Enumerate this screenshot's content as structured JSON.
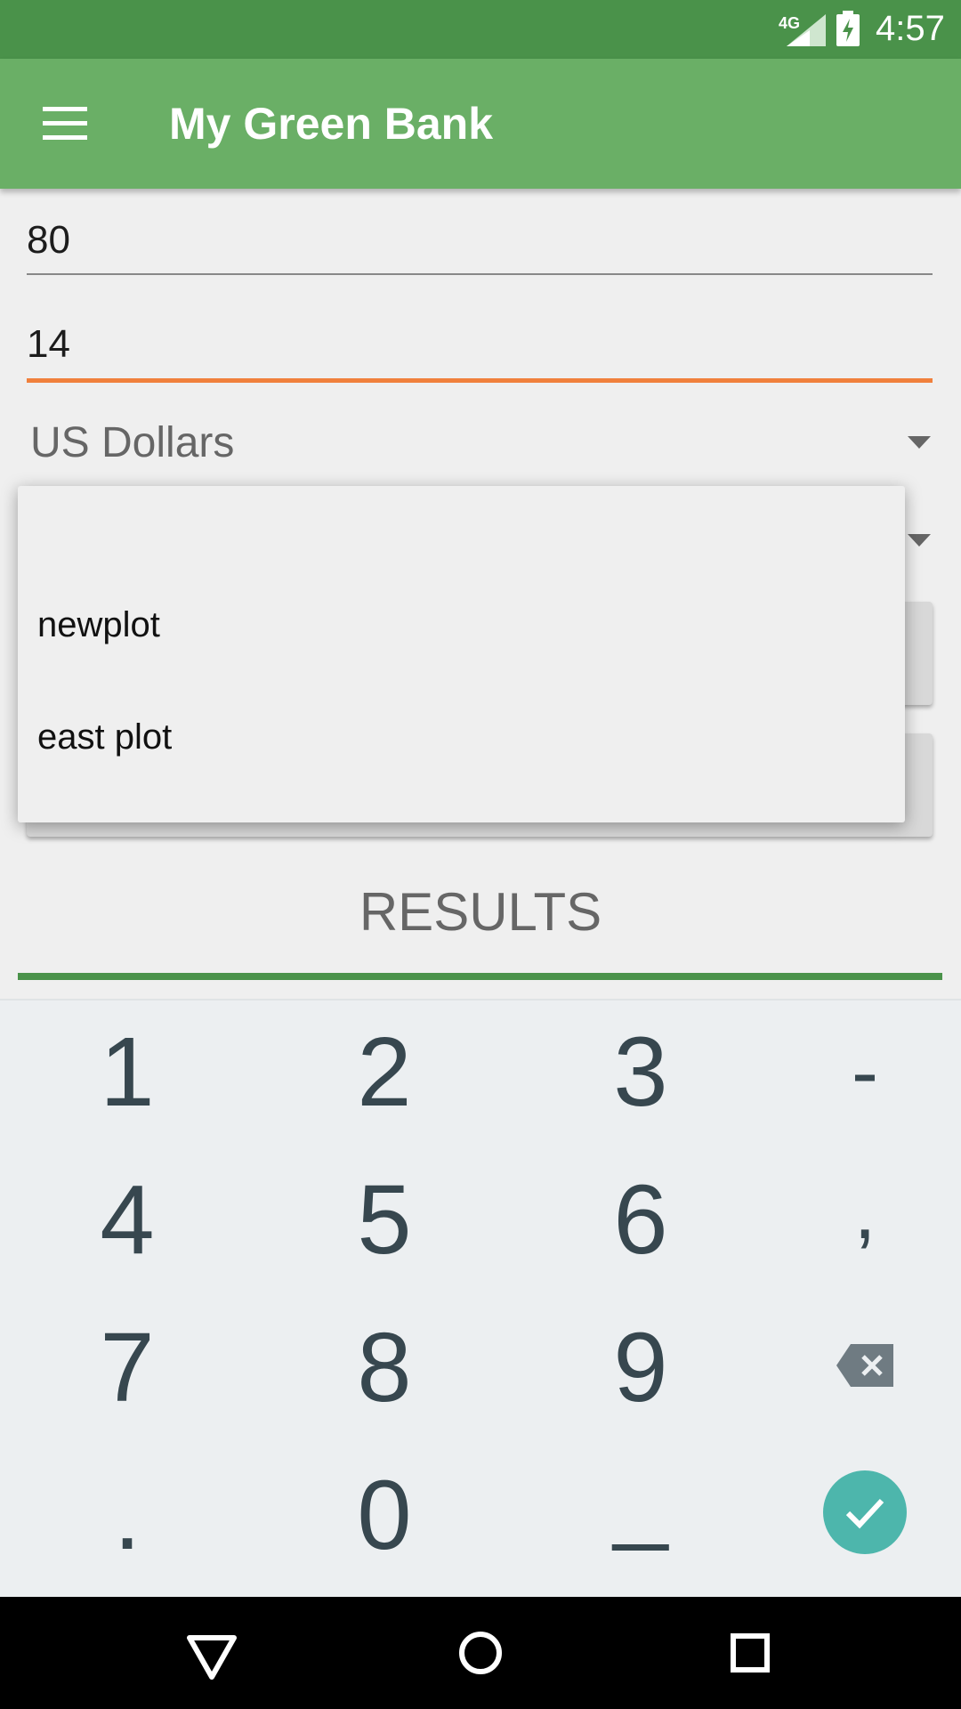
{
  "status_bar": {
    "network": "4G",
    "time": "4:57"
  },
  "app_bar": {
    "title": "My Green Bank",
    "menu_icon": "menu-icon"
  },
  "form": {
    "field_1_value": "80",
    "field_2_value": "14",
    "currency_selected": "US Dollars"
  },
  "popup": {
    "items": [
      "",
      "newplot",
      "east plot"
    ]
  },
  "results": {
    "tab_label": "RESULTS"
  },
  "keypad": {
    "keys": [
      [
        "1",
        "2",
        "3",
        "-"
      ],
      [
        "4",
        "5",
        "6",
        ","
      ],
      [
        "7",
        "8",
        "9",
        "backspace"
      ],
      [
        ".",
        "0",
        "_",
        "done"
      ]
    ]
  },
  "colors": {
    "status_bar": "#4a924a",
    "app_bar": "#6aaf66",
    "focus_underline": "#f0803c",
    "results_indicator": "#4a924a",
    "done_button": "#4db6ac",
    "key_text": "#37474f"
  }
}
